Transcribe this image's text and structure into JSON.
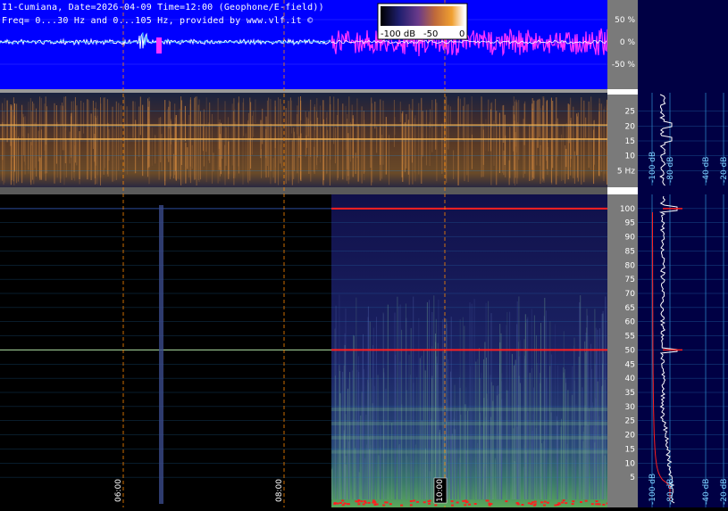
{
  "header": {
    "line1": "I1-Cumiana, Date=2026-04-09 Time=12:00 (Geophone/E-field))",
    "line2": "Freq= 0...30 Hz and 0...105 Hz, provided by www.vlf.it ©"
  },
  "colorbar": {
    "labels": [
      "-100 dB",
      "-50",
      "0"
    ],
    "colors": [
      "#000000",
      "#1e1e6e",
      "#6a3a8a",
      "#c06a3a",
      "#f0a030",
      "#ffffff"
    ]
  },
  "colors": {
    "waveform_bg": "#0000ff",
    "waveform_trace": "#ffffff",
    "waveform_early": "#33ccff",
    "waveform_late": "#ff33ff",
    "right_panel_bg": "#000044",
    "axis_strip_bg": "#7a7a7a",
    "grid_cyan": "#2a7fbf",
    "marker_line": "#ff8800",
    "spectrum_red": "#ff2020"
  },
  "chart_data": [
    {
      "type": "line",
      "panel": "waveform",
      "ylabels": [
        "50 %",
        "0 %",
        "-50 %"
      ],
      "yticks": [
        50,
        0,
        -50
      ],
      "ylim": [
        -100,
        100
      ],
      "time_markers": [
        "06:00",
        "08:00",
        "10:00"
      ]
    },
    {
      "type": "heatmap",
      "panel": "spectrogram-low",
      "ylabels": [
        "25",
        "20",
        "15",
        "10",
        "5 Hz"
      ],
      "yticks": [
        25,
        20,
        15,
        10,
        5
      ],
      "ylim": [
        0,
        30
      ],
      "grid": true,
      "prominent_lines_hz": [
        15.6,
        20.3
      ]
    },
    {
      "type": "heatmap",
      "panel": "spectrogram-high",
      "ylabels": [
        "100",
        "95",
        "90",
        "85",
        "80",
        "75",
        "70",
        "65",
        "60",
        "55",
        "50",
        "45",
        "40",
        "35",
        "30",
        "25",
        "20",
        "15",
        "10",
        "5"
      ],
      "yticks": [
        100,
        95,
        90,
        85,
        80,
        75,
        70,
        65,
        60,
        55,
        50,
        45,
        40,
        35,
        30,
        25,
        20,
        15,
        10,
        5
      ],
      "ylim": [
        0,
        105
      ],
      "grid": true,
      "prominent_lines_hz": [
        100,
        50
      ],
      "time_labels": [
        "06:00",
        "08:00",
        "10:00"
      ]
    },
    {
      "type": "line",
      "panel": "spectrum-low",
      "xlabels": [
        "-100 dB",
        "-80 dB",
        "-40 dB",
        "-20 dB"
      ],
      "xticks": [
        -100,
        -80,
        -40,
        -20
      ],
      "ylim": [
        0,
        30
      ],
      "peaks_hz": [
        15.6,
        20.3
      ]
    },
    {
      "type": "line",
      "panel": "spectrum-high",
      "xlabels": [
        "-100 dB",
        "-80 dB",
        "-40 dB",
        "-20 dB"
      ],
      "xticks": [
        -100,
        -80,
        -40,
        -20
      ],
      "ylim": [
        0,
        105
      ],
      "peaks_hz": [
        100,
        50
      ]
    }
  ]
}
